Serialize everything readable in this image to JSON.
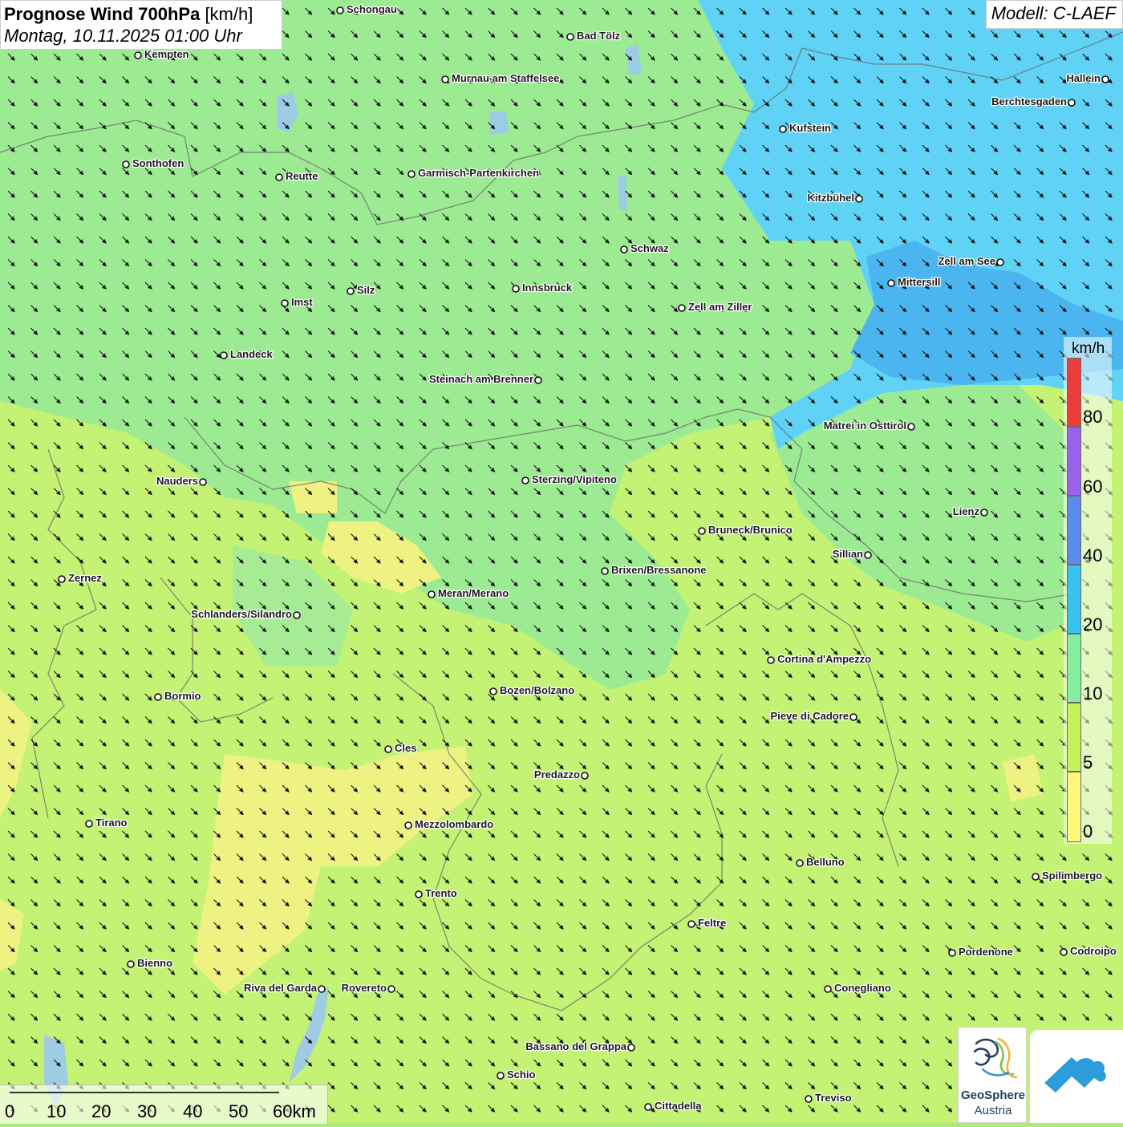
{
  "header": {
    "title_bold": "Prognose Wind 700hPa",
    "title_unit": "[km/h]",
    "datetime": "Montag, 10.11.2025 01:00 Uhr",
    "model": "Modell: C-LAEF"
  },
  "legend": {
    "unit": "km/h",
    "ticks": [
      "0",
      "5",
      "10",
      "20",
      "40",
      "60",
      "80"
    ],
    "colors": [
      "#fdf77a",
      "#c4f25a",
      "#86eea0",
      "#37c3ee",
      "#5b8cec",
      "#9a62ea",
      "#ee3b3b",
      "#a9dcf4"
    ]
  },
  "scale_bar": {
    "labels": [
      "0",
      "10",
      "20",
      "30",
      "40",
      "50",
      "60km"
    ]
  },
  "logos": {
    "geosphere_line1": "GeoSphere",
    "geosphere_line2": "Austria"
  },
  "cities": [
    {
      "name": "Schongau"
    },
    {
      "name": "Bad Tölz"
    },
    {
      "name": "Kempten"
    },
    {
      "name": "Murnau am Staffelsee"
    },
    {
      "name": "Hallein"
    },
    {
      "name": "Berchtesgaden"
    },
    {
      "name": "Kufstein"
    },
    {
      "name": "Sonthofen"
    },
    {
      "name": "Reutte"
    },
    {
      "name": "Garmisch-Partenkirchen"
    },
    {
      "name": "Kitzbühel"
    },
    {
      "name": "Schwaz"
    },
    {
      "name": "Zell am See"
    },
    {
      "name": "Mittersill"
    },
    {
      "name": "Innsbruck"
    },
    {
      "name": "Silz"
    },
    {
      "name": "Imst"
    },
    {
      "name": "Zell am Ziller"
    },
    {
      "name": "Landeck"
    },
    {
      "name": "Steinach am Brenner"
    },
    {
      "name": "Matrei in Osttirol"
    },
    {
      "name": "Nauders"
    },
    {
      "name": "Sterzing/Vipiteno"
    },
    {
      "name": "Lienz"
    },
    {
      "name": "Bruneck/Brunico"
    },
    {
      "name": "Sillian"
    },
    {
      "name": "Brixen/Bressanone"
    },
    {
      "name": "Zernez"
    },
    {
      "name": "Meran/Merano"
    },
    {
      "name": "Schlanders/Silandro"
    },
    {
      "name": "Cortina d'Ampezzo"
    },
    {
      "name": "Bozen/Bolzano"
    },
    {
      "name": "Bormio"
    },
    {
      "name": "Pieve di Cadore"
    },
    {
      "name": "Cles"
    },
    {
      "name": "Predazzo"
    },
    {
      "name": "Tirano"
    },
    {
      "name": "Mezzolombardo"
    },
    {
      "name": "Belluno"
    },
    {
      "name": "Spilimbergo"
    },
    {
      "name": "Trento"
    },
    {
      "name": "Feltre"
    },
    {
      "name": "Pordenone"
    },
    {
      "name": "Codroipo"
    },
    {
      "name": "Bienno"
    },
    {
      "name": "Riva del Garda"
    },
    {
      "name": "Rovereto"
    },
    {
      "name": "Conegliano"
    },
    {
      "name": "Bassano del Grappa"
    },
    {
      "name": "Schio"
    },
    {
      "name": "Treviso"
    },
    {
      "name": "Cittadella"
    }
  ]
}
